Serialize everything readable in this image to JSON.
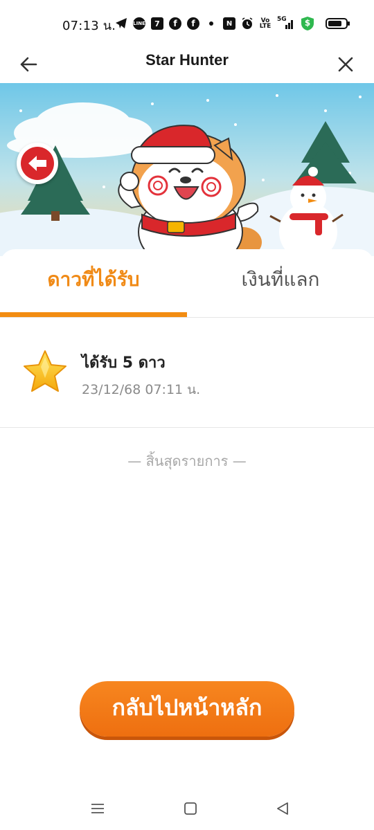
{
  "status_bar": {
    "time": "07:13 น.",
    "icons": [
      "telegram-icon",
      "line-icon",
      "seven-eleven-icon",
      "facebook-icon",
      "facebook-icon",
      "dot-icon",
      "nfc-icon",
      "alarm-icon",
      "volte-icon",
      "signal-5g-icon",
      "shield-dollar-icon",
      "battery-icon"
    ],
    "volte_label": "Vo LTE",
    "network_label": "5G",
    "shield_symbol": "$"
  },
  "header": {
    "title": "Star Hunter",
    "back_icon": "arrow-left-icon",
    "close_icon": "close-icon"
  },
  "banner": {
    "back_button_icon": "arrow-left-icon"
  },
  "tabs": [
    {
      "label": "ดาวที่ได้รับ",
      "active": true
    },
    {
      "label": "เงินที่แลก",
      "active": false
    }
  ],
  "history": [
    {
      "icon": "star-icon",
      "title": "ได้รับ 5 ดาว",
      "date": "23/12/68 07:11 น."
    }
  ],
  "end_of_list": "— สิ้นสุดรายการ —",
  "home_button": {
    "label": "กลับไปหน้าหลัก"
  },
  "nav_bar": {
    "items": [
      "menu-icon",
      "home-square-icon",
      "back-triangle-icon"
    ]
  },
  "colors": {
    "accent": "#f08a16",
    "button": "#ee7414",
    "banner_back": "#d9272b",
    "text_muted": "#8a8a8a"
  }
}
